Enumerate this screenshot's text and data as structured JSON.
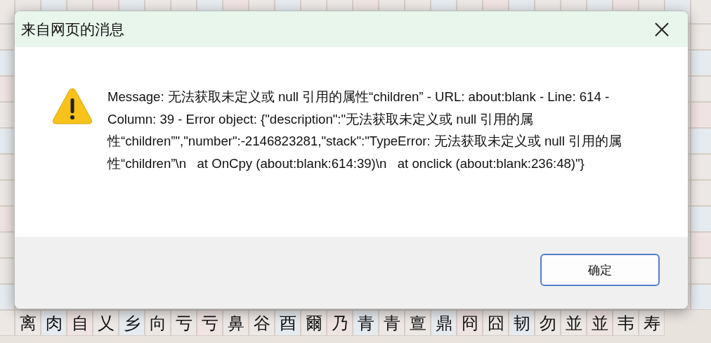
{
  "background_grid": {
    "cells": [
      "离",
      "肉",
      "自",
      "乂",
      "乡",
      "向",
      "亏",
      "亏",
      "鼻",
      "谷",
      "酉",
      "爾",
      "乃",
      "青",
      "青",
      "亶",
      "鼎",
      "冏",
      "囧",
      "韧",
      "勿",
      "並",
      "並",
      "韦",
      "寿"
    ]
  },
  "dialog": {
    "title": "来自网页的消息",
    "message": "Message: 无法获取未定义或 null 引用的属性“children” - URL: about:blank - Line: 614 - Column: 39 - Error object: {\"description\":\"无法获取未定义或 null 引用的属性“children”\",\"number\":-2146823281,\"stack\":\"TypeError: 无法获取未定义或 null 引用的属性“children”\\n   at OnCpy (about:blank:614:39)\\n   at onclick (about:blank:236:48)\"}",
    "buttons": [
      {
        "label": "确定"
      }
    ]
  }
}
